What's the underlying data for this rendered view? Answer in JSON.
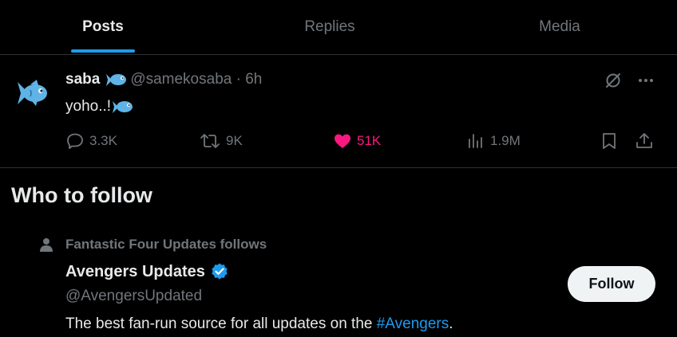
{
  "tabs": [
    {
      "label": "Posts",
      "active": true
    },
    {
      "label": "Replies",
      "active": false
    },
    {
      "label": "Media",
      "active": false
    }
  ],
  "post": {
    "name": "saba",
    "handle_time": "@samekosaba · 6h",
    "text": "yoho..!",
    "avatar_icon": "blue-fish-emoji",
    "stats": {
      "replies": "3.3K",
      "reposts": "9K",
      "likes": "51K",
      "views": "1.9M"
    }
  },
  "who_to_follow": {
    "title": "Who to follow",
    "social_context": "Fantastic Four Updates follows",
    "account": {
      "name": "Avengers Updates",
      "handle": "@AvengersUpdated",
      "bio_prefix": "The best fan-run source for all updates on the ",
      "bio_hashtag": "#Avengers",
      "bio_suffix": ".",
      "verified": true
    },
    "follow_label": "Follow"
  },
  "colors": {
    "background": "#000000",
    "accent": "#1d9bf0",
    "like": "#f91880",
    "muted": "#71767b",
    "text": "#e7e9ea",
    "divider": "#2f3336"
  }
}
